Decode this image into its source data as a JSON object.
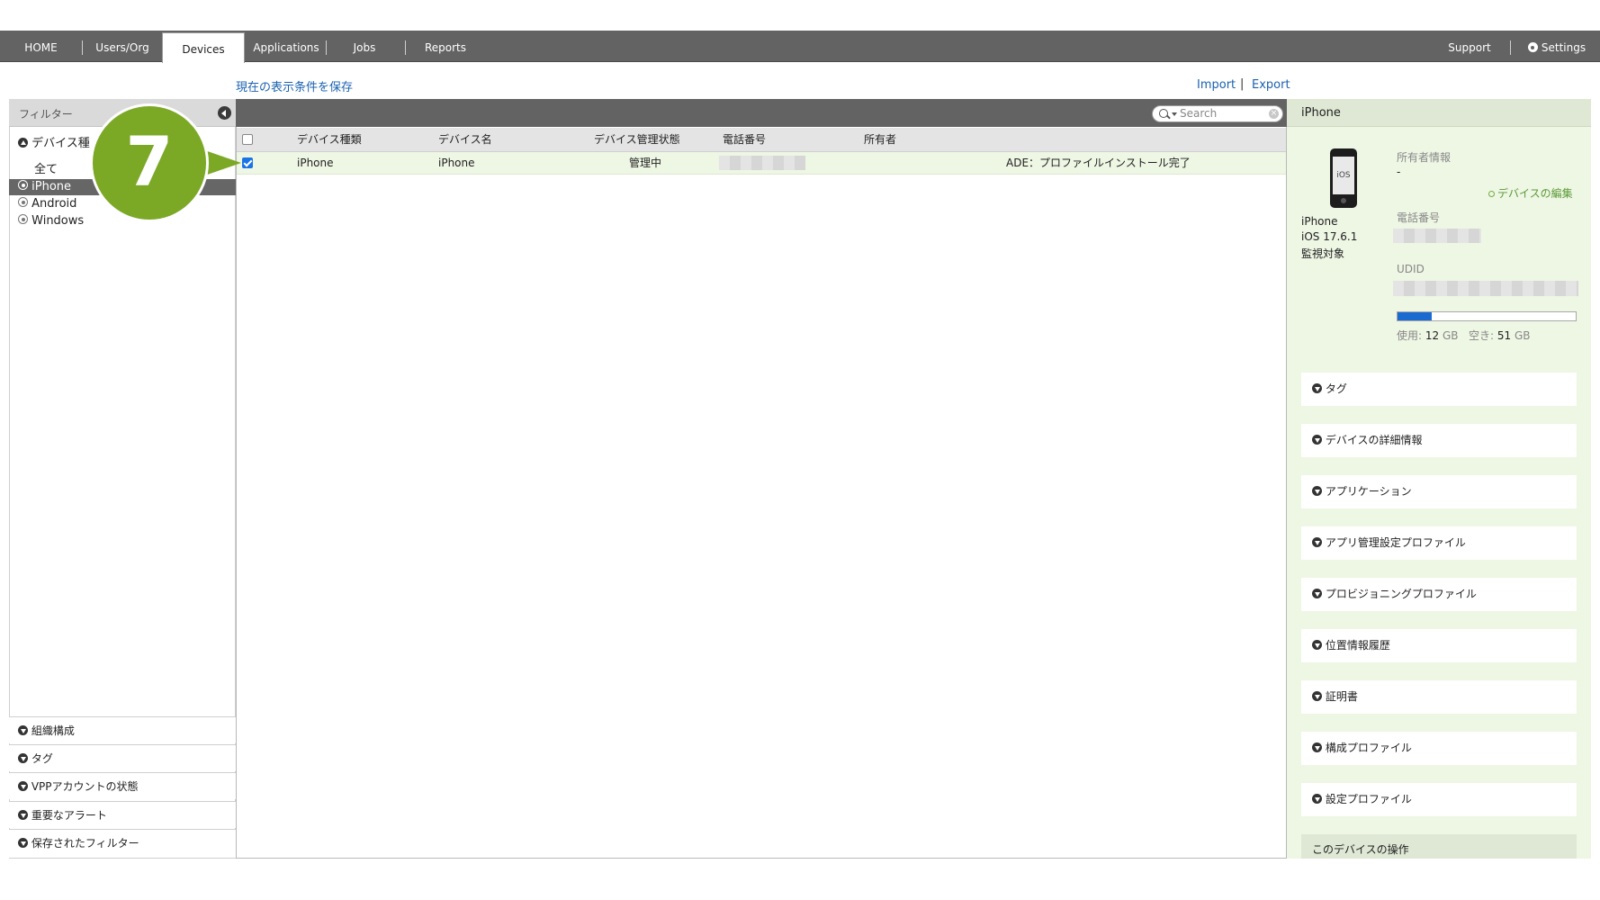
{
  "nav": {
    "items": [
      "HOME",
      "Users/Org",
      "Devices",
      "Applications",
      "Jobs",
      "Reports"
    ],
    "active": "Devices",
    "support": "Support",
    "settings": "Settings"
  },
  "toolbar": {
    "save_view": "現在の表示条件を保存",
    "import": "Import",
    "sep": "|",
    "export": "Export"
  },
  "filter": {
    "title": "フィルター",
    "device_type_header": "デバイス種",
    "options": [
      "全て",
      "iPhone",
      "Android",
      "Windows"
    ],
    "selected": "iPhone",
    "sections": [
      "組織構成",
      "タグ",
      "VPPアカウントの状態",
      "重要なアラート",
      "保存されたフィルター"
    ]
  },
  "callout": {
    "number": "7"
  },
  "search": {
    "placeholder": "Search"
  },
  "table": {
    "headers": [
      "デバイス種類",
      "デバイス名",
      "デバイス管理状態",
      "電話番号",
      "所有者"
    ],
    "rows": [
      {
        "checked": true,
        "type": "iPhone",
        "name": "iPhone",
        "status": "管理中",
        "owner": "",
        "note": "ADE：プロファイルインストール完了"
      }
    ]
  },
  "detail": {
    "header": "iPhone",
    "device_icon_label": "iOS",
    "model": "iPhone",
    "os": "iOS 17.6.1",
    "supervised": "監視対象",
    "owner_label": "所有者情報",
    "owner_value": "-",
    "edit_link": "デバイスの編集",
    "phone_label": "電話番号",
    "udid_label": "UDID",
    "storage": {
      "used_label": "使用:",
      "used_value": "12",
      "used_unit": "GB",
      "free_label": "空き:",
      "free_value": "51",
      "free_unit": "GB",
      "used_fraction": 0.19
    },
    "sections": [
      "タグ",
      "デバイスの詳細情報",
      "アプリケーション",
      "アプリ管理設定プロファイル",
      "プロビジョニングプロファイル",
      "位置情報履歴",
      "証明書",
      "構成プロファイル",
      "設定プロファイル"
    ],
    "actions_title": "このデバイスの操作"
  },
  "colors": {
    "nav_bg": "#636363",
    "accent_green": "#7ba825",
    "selected_row": "#eef6e4",
    "link_blue": "#1a62b0",
    "storage_blue": "#1a6ad0"
  }
}
